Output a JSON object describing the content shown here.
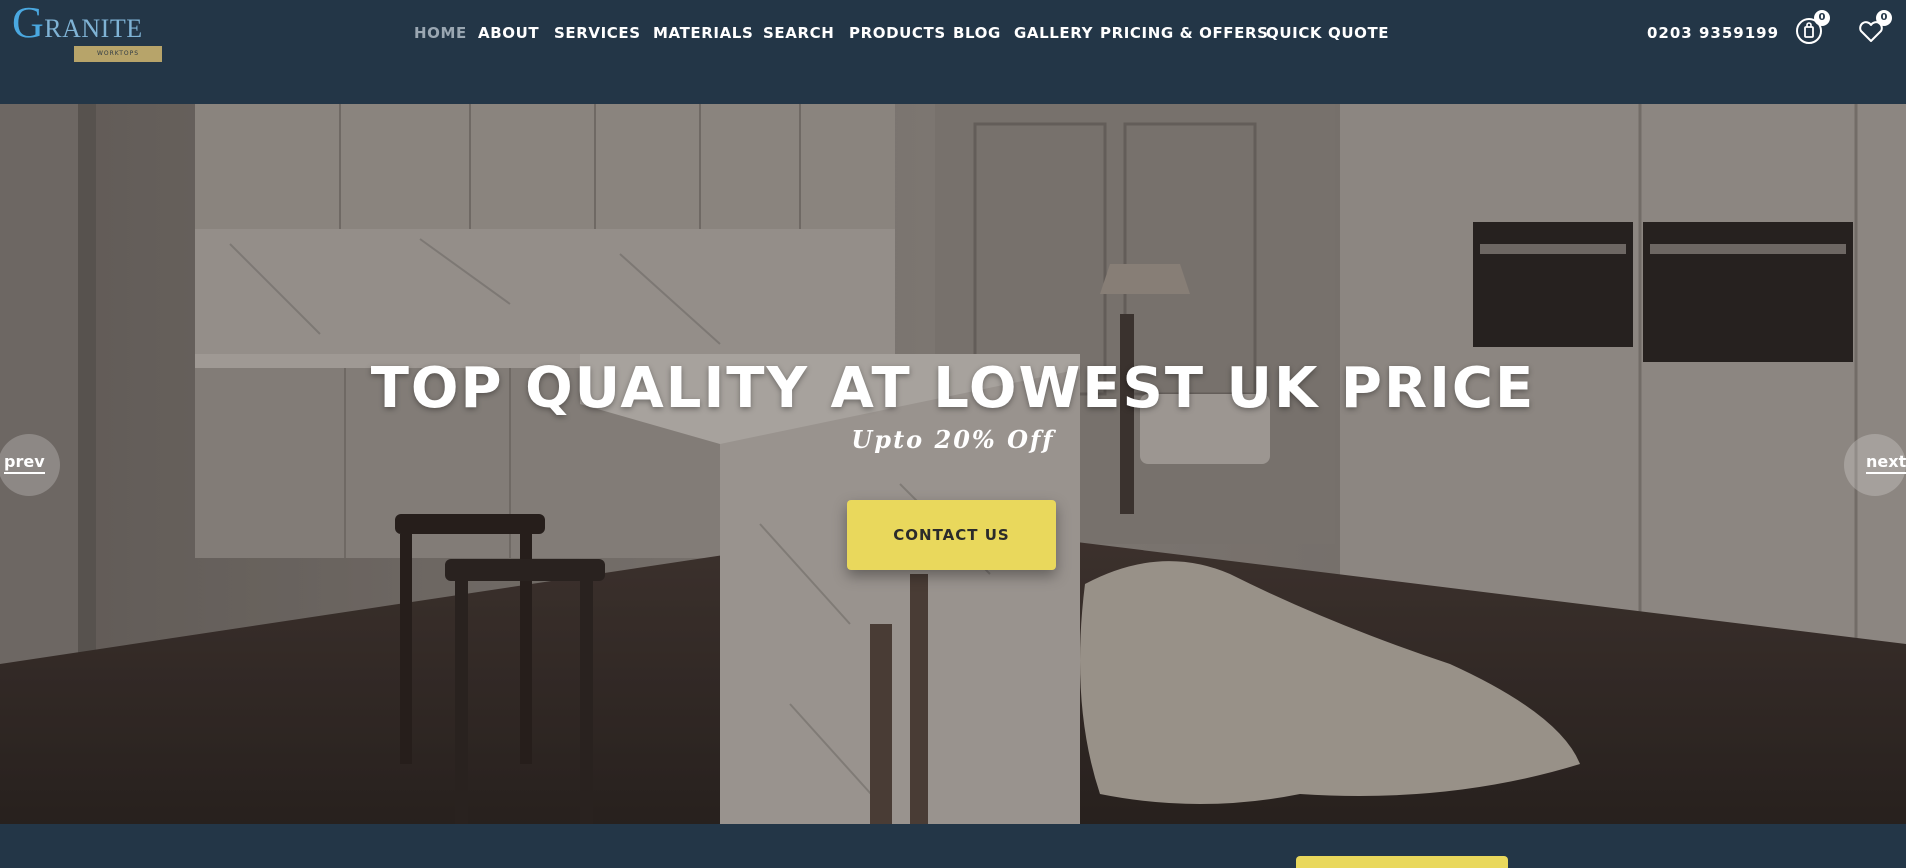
{
  "brand": {
    "logo_text": "GRANITE",
    "logo_initial": "G",
    "logo_rest": "RANITE",
    "tagline": "WORKTOPS",
    "colors": {
      "header_bg": "#233647",
      "accent_yellow": "#e9d85c",
      "logo_blue": "#4aa8e0"
    }
  },
  "nav": {
    "items": [
      {
        "label": "HOME",
        "active": true
      },
      {
        "label": "ABOUT"
      },
      {
        "label": "SERVICES"
      },
      {
        "label": "MATERIALS"
      },
      {
        "label": "SEARCH"
      },
      {
        "label": "PRODUCTS"
      },
      {
        "label": "BLOG"
      },
      {
        "label": "GALLERY"
      },
      {
        "label": "PRICING & OFFERS"
      },
      {
        "label": "QUICK QUOTE"
      }
    ]
  },
  "header": {
    "phone": "0203 9359199",
    "cart": {
      "icon": "cart-icon",
      "count": "0"
    },
    "wishlist": {
      "icon": "heart-icon",
      "count": "0"
    }
  },
  "hero": {
    "title": "TOP QUALITY AT LOWEST UK PRICE",
    "subtitle": "Upto 20% Off",
    "cta_label": "CONTACT US",
    "prev_label": "prev",
    "next_label": "next"
  }
}
